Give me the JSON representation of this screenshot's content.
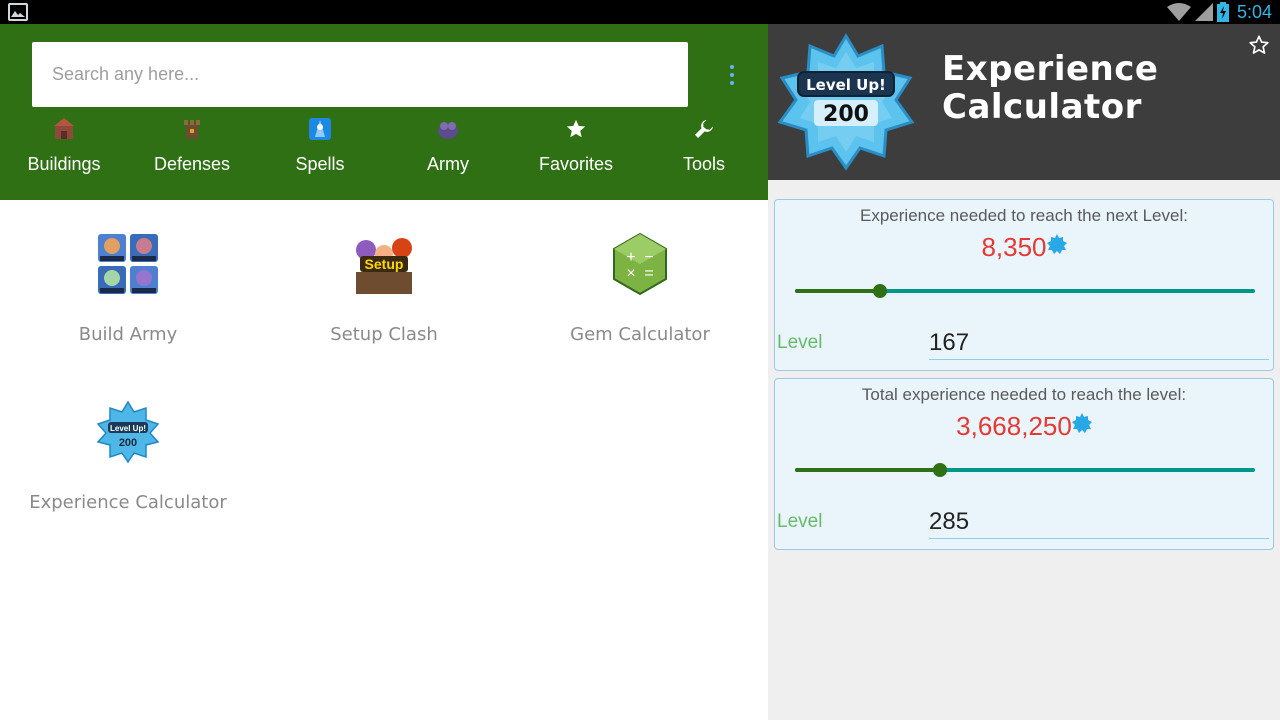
{
  "status_bar": {
    "time": "5:04",
    "icons": [
      "image-icon",
      "wifi-icon",
      "signal-icon",
      "battery-icon"
    ]
  },
  "search": {
    "placeholder": "Search any here...",
    "value": ""
  },
  "tabs": [
    {
      "label": "Buildings",
      "icon": "buildings-icon"
    },
    {
      "label": "Defenses",
      "icon": "defenses-icon"
    },
    {
      "label": "Spells",
      "icon": "spells-icon"
    },
    {
      "label": "Army",
      "icon": "army-icon"
    },
    {
      "label": "Favorites",
      "icon": "star-icon"
    },
    {
      "label": "Tools",
      "icon": "wrench-icon",
      "selected": true
    }
  ],
  "tools": [
    {
      "label": "Build Army",
      "icon": "build-army-icon"
    },
    {
      "label": "Setup Clash",
      "icon": "setup-clash-icon"
    },
    {
      "label": "Gem Calculator",
      "icon": "gem-calculator-icon"
    },
    {
      "label": "Experience Calculator",
      "icon": "level-up-badge-icon"
    }
  ],
  "detail": {
    "title_line1": "Experience",
    "title_line2": "Calculator",
    "badge_line1": "Level Up!",
    "badge_line2": "200",
    "favorite_icon": "star-outline-icon",
    "cards": [
      {
        "title": "Experience needed to reach the next Level:",
        "value": "8,350",
        "level_label": "Level",
        "level": "167",
        "slider_fraction": 0.185
      },
      {
        "title": "Total experience needed to reach the level:",
        "value": "3,668,250",
        "level_label": "Level",
        "level": "285",
        "slider_fraction": 0.316
      }
    ]
  },
  "colors": {
    "appbar": "#2e7013",
    "header": "#3d3d3d",
    "value_red": "#e53935",
    "label_green": "#66bb6a",
    "slider_teal": "#009688",
    "time_blue": "#33b5e5"
  }
}
